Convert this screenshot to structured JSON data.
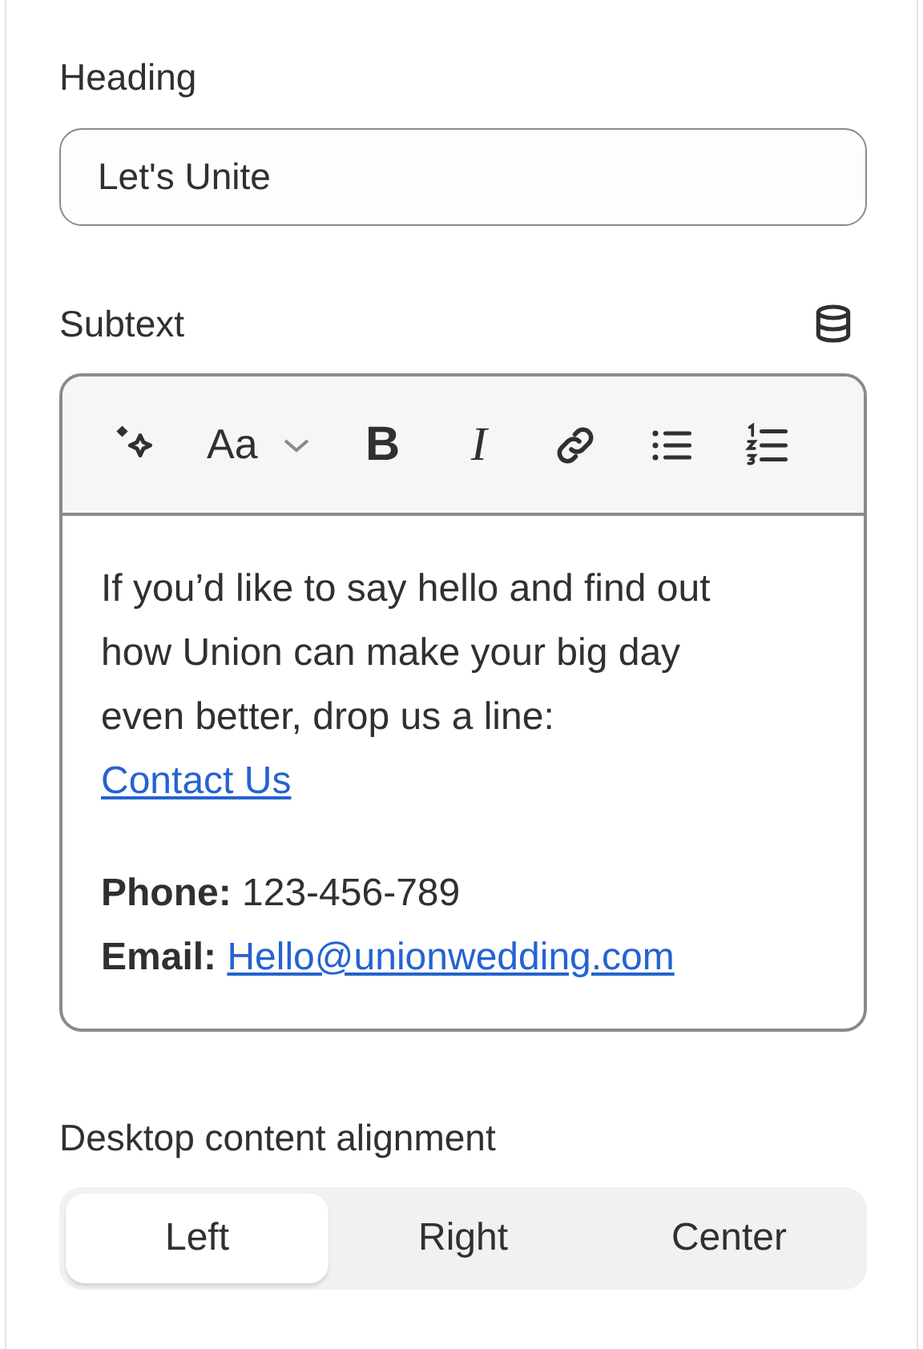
{
  "heading": {
    "label": "Heading",
    "value": "Let's Unite"
  },
  "subtext": {
    "label": "Subtext",
    "toolbar": [
      {
        "kind": "ai"
      },
      {
        "kind": "text-style",
        "label": "Aa"
      },
      {
        "kind": "bold",
        "label": "B"
      },
      {
        "kind": "italic",
        "label": "I"
      },
      {
        "kind": "link"
      },
      {
        "kind": "bullets"
      },
      {
        "kind": "numbers"
      }
    ],
    "paragraph": {
      "text": "If you’d like to say hello and find out how Union can make your big day even better, drop us a line:",
      "link": "Contact Us"
    },
    "contacts": [
      {
        "label": "Phone:",
        "value": "123-456-789",
        "kind": "text"
      },
      {
        "label": "Email:",
        "value": "Hello@unionwedding.com",
        "kind": "link"
      }
    ]
  },
  "alignment": {
    "label": "Desktop content alignment",
    "options": [
      {
        "label": "Left",
        "selected": true
      },
      {
        "label": "Right",
        "selected": false
      },
      {
        "label": "Center",
        "selected": false
      }
    ]
  }
}
